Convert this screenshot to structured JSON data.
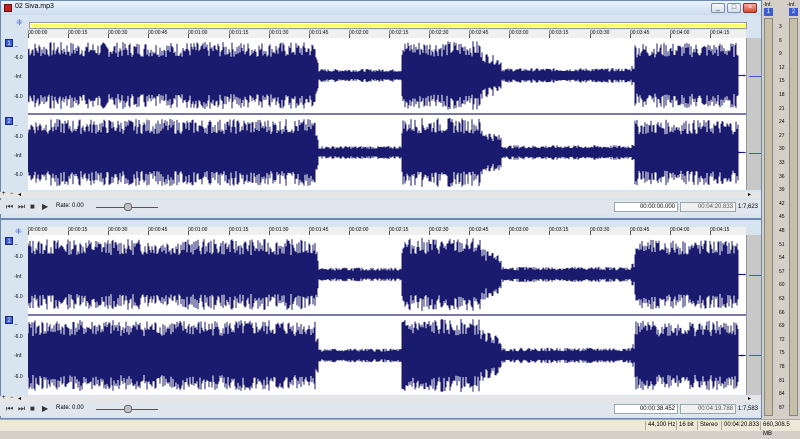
{
  "window": {
    "title": "02 Siva.mp3",
    "min_icon": "minimize-icon",
    "max_icon": "maximize-icon",
    "close_icon": "close-icon"
  },
  "colors": {
    "waveform": "#1a1a6e",
    "accent": "#3a5ad8",
    "selection": "#ffff66"
  },
  "ruler": {
    "labels": [
      "00:00:00",
      "00:00:15",
      "00:00:30",
      "00:00:45",
      "00:01:00",
      "00:01:15",
      "00:01:30",
      "00:01:45",
      "00:02:00",
      "00:02:15",
      "00:02:30",
      "00:02:45",
      "00:03:00",
      "00:03:15",
      "00:03:30",
      "00:03:45",
      "00:04:00",
      "00:04:15"
    ]
  },
  "channels": {
    "ch1_label": "1",
    "ch2_label": "2",
    "db_labels": [
      "-6.0",
      "-Inf.",
      "-6.0"
    ]
  },
  "top_panel": {
    "rate_label": "Rate: 0.00",
    "cursor_pos": "00:00:00.000",
    "length": "00:04:20.833",
    "zoom": "1:7,623"
  },
  "bottom_panel": {
    "rate_label": "Rate: 0.00",
    "cursor_pos": "00:00:38.452",
    "length": "00:04:19.788",
    "zoom": "1:7,583"
  },
  "meters": {
    "ch1_label": "1",
    "ch2_label": "2",
    "top_labels": [
      "-Inf.",
      "-Inf."
    ],
    "scale": [
      "3",
      "6",
      "9",
      "12",
      "15",
      "18",
      "21",
      "24",
      "27",
      "30",
      "33",
      "36",
      "39",
      "42",
      "45",
      "48",
      "51",
      "54",
      "57",
      "60",
      "63",
      "66",
      "69",
      "72",
      "75",
      "78",
      "81",
      "84",
      "87"
    ]
  },
  "status": {
    "sample_rate": "44,100 Hz",
    "bit_depth": "16 bit",
    "channels": "Stereo",
    "duration": "00:04:20.833",
    "disk": "660,308.5 MB"
  }
}
